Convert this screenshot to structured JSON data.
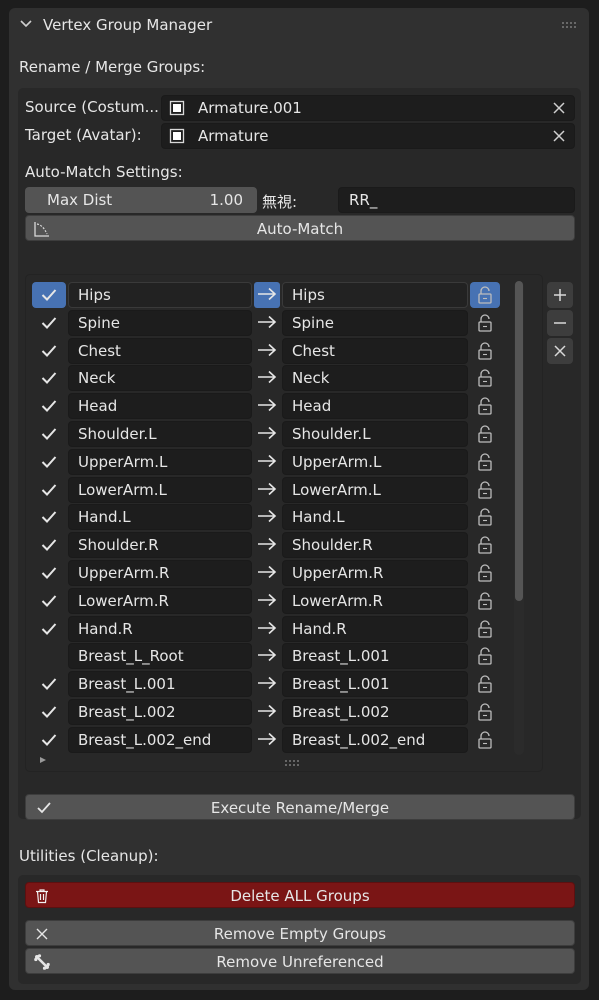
{
  "panel": {
    "title": "Vertex Group Manager",
    "rename_section_label": "Rename / Merge Groups:",
    "source": {
      "label": "Source (Costum...",
      "value": "Armature.001"
    },
    "target": {
      "label": "Target (Avatar):",
      "value": "Armature"
    },
    "auto_match": {
      "label": "Auto-Match Settings:",
      "max_dist_label": "Max Dist",
      "max_dist_value": "1.00",
      "ignore_label": "無視:",
      "ignore_value": "RR_",
      "button_label": "Auto-Match"
    },
    "mapping_rows": [
      {
        "checked": true,
        "source": "Hips",
        "target": "Hips",
        "selected": true
      },
      {
        "checked": true,
        "source": "Spine",
        "target": "Spine"
      },
      {
        "checked": true,
        "source": "Chest",
        "target": "Chest"
      },
      {
        "checked": true,
        "source": "Neck",
        "target": "Neck"
      },
      {
        "checked": true,
        "source": "Head",
        "target": "Head"
      },
      {
        "checked": true,
        "source": "Shoulder.L",
        "target": "Shoulder.L"
      },
      {
        "checked": true,
        "source": "UpperArm.L",
        "target": "UpperArm.L"
      },
      {
        "checked": true,
        "source": "LowerArm.L",
        "target": "LowerArm.L"
      },
      {
        "checked": true,
        "source": "Hand.L",
        "target": "Hand.L"
      },
      {
        "checked": true,
        "source": "Shoulder.R",
        "target": "Shoulder.R"
      },
      {
        "checked": true,
        "source": "UpperArm.R",
        "target": "UpperArm.R"
      },
      {
        "checked": true,
        "source": "LowerArm.R",
        "target": "LowerArm.R"
      },
      {
        "checked": true,
        "source": "Hand.R",
        "target": "Hand.R"
      },
      {
        "checked": false,
        "source": "Breast_L_Root",
        "target": "Breast_L.001"
      },
      {
        "checked": true,
        "source": "Breast_L.001",
        "target": "Breast_L.001"
      },
      {
        "checked": true,
        "source": "Breast_L.002",
        "target": "Breast_L.002"
      },
      {
        "checked": true,
        "source": "Breast_L.002_end",
        "target": "Breast_L.002_end"
      }
    ],
    "execute_button_label": "Execute Rename/Merge",
    "utilities_label": "Utilities (Cleanup):",
    "delete_all_label": "Delete ALL Groups",
    "remove_empty_label": "Remove Empty Groups",
    "remove_unreferenced_label": "Remove Unreferenced"
  },
  "colors": {
    "accent": "#4772b3",
    "danger": "#7a1515",
    "panel_bg": "#303030",
    "field_bg": "#1d1d1d"
  },
  "icons": {
    "collapse": "chevron-down-icon",
    "object": "object-icon",
    "clear": "close-icon",
    "curve": "curve-icon",
    "check": "check-icon",
    "arrow": "arrow-right-icon",
    "lock": "unlock-icon",
    "add": "plus-icon",
    "remove": "minus-icon",
    "delete": "trash-icon",
    "bone": "bone-icon"
  }
}
